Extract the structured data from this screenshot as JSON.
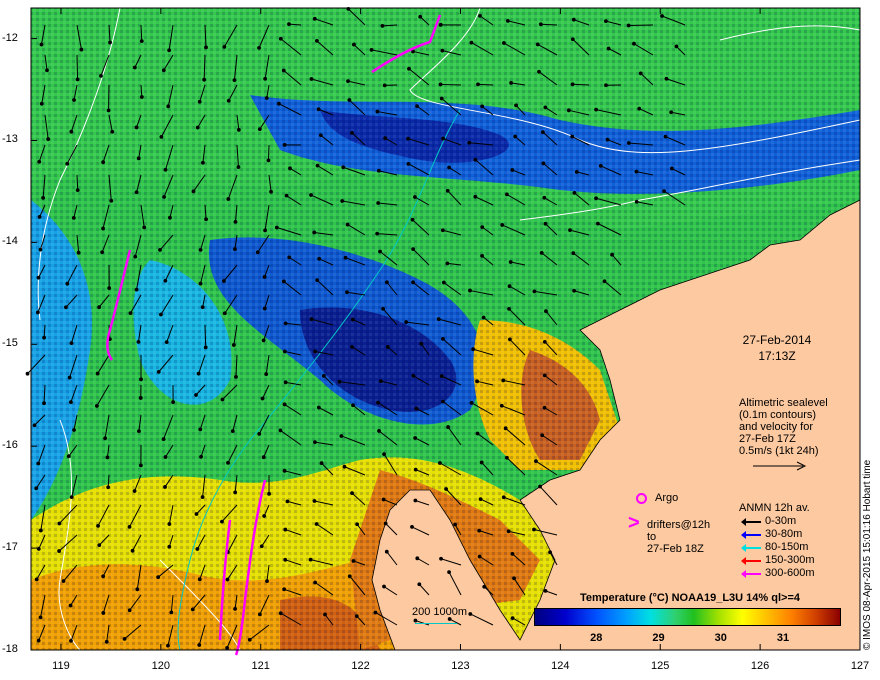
{
  "map": {
    "y_axis": {
      "ticks": [
        "-12",
        "-13",
        "-14",
        "-15",
        "-16",
        "-17",
        "-18"
      ],
      "range": [
        -18,
        -11.7
      ]
    },
    "x_axis": {
      "ticks": [
        "119",
        "120",
        "121",
        "122",
        "123",
        "124",
        "125",
        "126",
        "127"
      ],
      "range": [
        118.7,
        127
      ]
    },
    "date": {
      "line1": "27-Feb-2014",
      "line2": "17:13Z"
    },
    "altimetry": {
      "lines": [
        "Altimetric sealevel",
        "(0.1m contours)",
        "and velocity for",
        "27-Feb 17Z",
        "0.5m/s (1kt 24h)"
      ]
    },
    "argo_label": "Argo",
    "drifters": {
      "symbol": ">",
      "line1": "drifters@12h to",
      "line2": "27-Feb 18Z"
    },
    "anmn": {
      "title": "ANMN 12h av.",
      "items": [
        {
          "label": "0-30m",
          "color": "#000000"
        },
        {
          "label": "30-80m",
          "color": "#0000ff"
        },
        {
          "label": "80-150m",
          "color": "#00e0e0"
        },
        {
          "label": "150-300m",
          "color": "#ff0000"
        },
        {
          "label": "300-600m",
          "color": "#ff00ff"
        }
      ]
    },
    "colorbar": {
      "title": "Temperature (°C) NOAA19_L3U 14% ql>=4",
      "ticks": [
        "28",
        "29",
        "30",
        "31"
      ],
      "range": [
        27.0,
        31.9
      ]
    },
    "contour_label": "200  1000m",
    "credit": "© IMOS 08-Apr-2015 15:01:16 Hobart time",
    "colors": {
      "land": "#fdc9a0",
      "contour": "#00c8c8",
      "sealevel": "#ffffff"
    }
  }
}
